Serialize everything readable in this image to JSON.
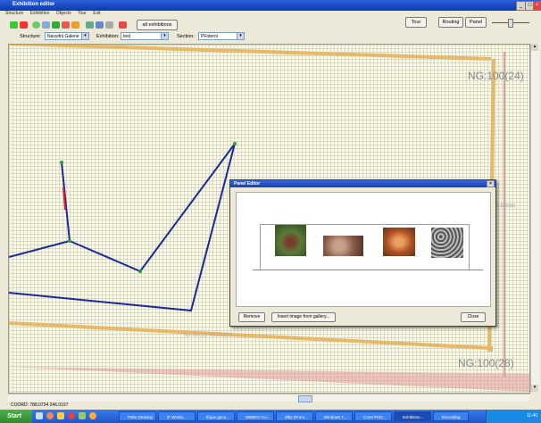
{
  "window": {
    "title": "Exhibition editor"
  },
  "menu": [
    "Structure",
    "Exhibition",
    "Objects",
    "Tour",
    "Exit"
  ],
  "toolbar": {
    "all_exhibitions_label": "all exhibitions",
    "right_buttons": [
      "Tour",
      "Routing",
      "Panel"
    ]
  },
  "selectors": {
    "structure_label": "Structure:",
    "structure_value": "Navydni Galerie",
    "exhibition_label": "Exhibition:",
    "exhibition_value": "test",
    "section_label": "Section:",
    "section_value": "PFoterol"
  },
  "canvas": {
    "label_top": "NG:100(24)",
    "label_bottom": "NG:100(28)",
    "label_side": "NG:100(26)",
    "label_lower": "NG:100(25) NG:100(27)",
    "colors": {
      "wall": "#e8b86a",
      "route": "#1a2a9c",
      "node": "#2aa02a",
      "hatch": "#d64a4a"
    }
  },
  "dialog": {
    "title": "Panel Editor",
    "images": [
      "moss-image",
      "shells-image",
      "moth-image",
      "cells-image"
    ],
    "remove_label": "Remove",
    "insert_label": "Insert image from gallery...",
    "close_label": "Close"
  },
  "status": {
    "coords": "COORD: 788.0734 246.0197"
  },
  "taskbar": {
    "start_label": "Start",
    "tasks": [
      "Paltu Desktop",
      "IF Windo...",
      "tfojue geno...",
      "WEBKO Co...",
      "dfby (Prom...",
      "Windows T...",
      "Corel PHO...",
      "Exhibition...",
      "Recording"
    ],
    "clock": "11:40"
  }
}
